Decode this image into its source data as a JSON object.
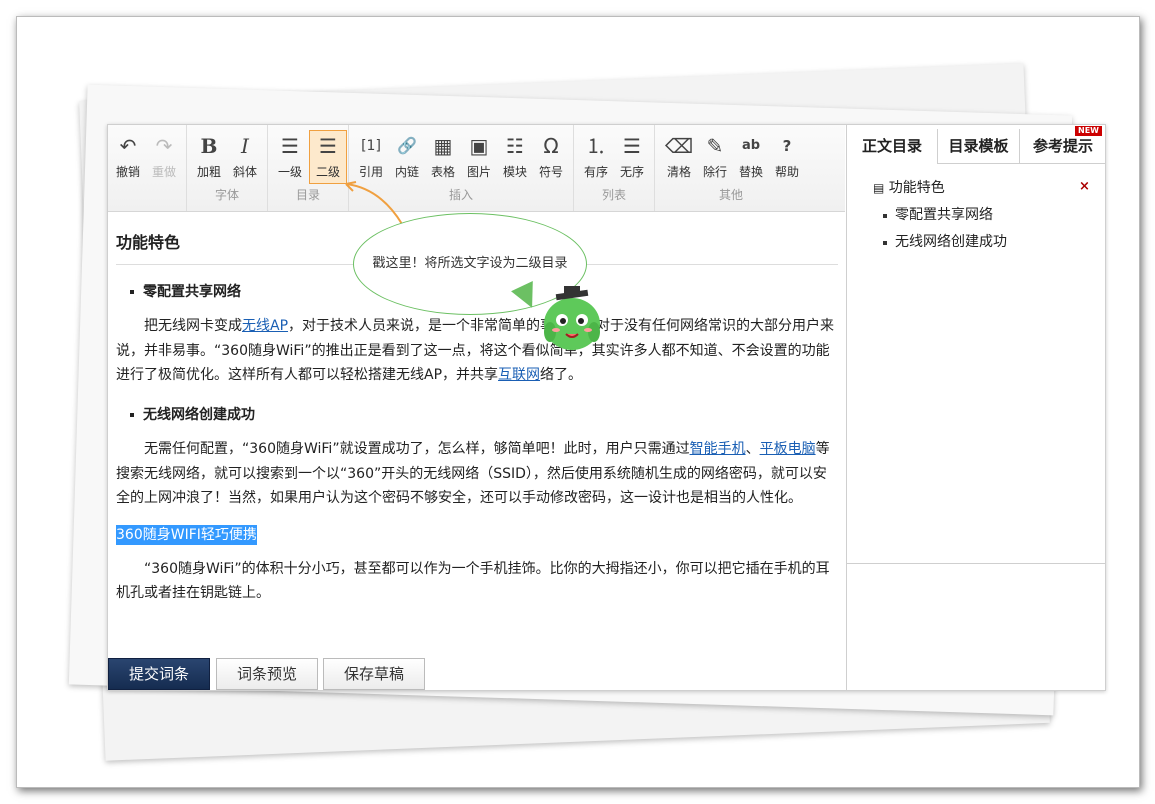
{
  "toolbar": {
    "groups": [
      {
        "label": "",
        "buttons": [
          {
            "icon": "undo-icon",
            "glyph": "↶",
            "label": "撤销"
          },
          {
            "icon": "redo-icon",
            "glyph": "↷",
            "label": "重做"
          }
        ]
      },
      {
        "label": "字体",
        "buttons": [
          {
            "icon": "bold-icon",
            "glyph": "B",
            "label": "加粗"
          },
          {
            "icon": "italic-icon",
            "glyph": "I",
            "label": "斜体"
          }
        ]
      },
      {
        "label": "目录",
        "buttons": [
          {
            "icon": "heading1-icon",
            "glyph": "☰",
            "label": "一级"
          },
          {
            "icon": "heading2-icon",
            "glyph": "☰",
            "label": "二级"
          }
        ]
      },
      {
        "label": "插入",
        "buttons": [
          {
            "icon": "quote-icon",
            "glyph": "[1]",
            "label": "引用"
          },
          {
            "icon": "link-icon",
            "glyph": "🔗",
            "label": "内链"
          },
          {
            "icon": "table-icon",
            "glyph": "▦",
            "label": "表格"
          },
          {
            "icon": "image-icon",
            "glyph": "▣",
            "label": "图片"
          },
          {
            "icon": "module-icon",
            "glyph": "☷",
            "label": "模块"
          },
          {
            "icon": "symbol-icon",
            "glyph": "Ω",
            "label": "符号"
          }
        ]
      },
      {
        "label": "列表",
        "buttons": [
          {
            "icon": "ordered-list-icon",
            "glyph": "⒈",
            "label": "有序"
          },
          {
            "icon": "unordered-list-icon",
            "glyph": "☰",
            "label": "无序"
          }
        ]
      },
      {
        "label": "其他",
        "buttons": [
          {
            "icon": "clear-format-icon",
            "glyph": "⌫",
            "label": "清格"
          },
          {
            "icon": "remove-format-icon",
            "glyph": "✎",
            "label": "除行"
          },
          {
            "icon": "replace-icon",
            "glyph": "ab",
            "label": "替换"
          },
          {
            "icon": "help-icon",
            "glyph": "?",
            "label": "帮助"
          }
        ]
      }
    ]
  },
  "side": {
    "tabs": [
      "正文目录",
      "目录模板",
      "参考提示"
    ],
    "new_badge": "NEW",
    "toc": {
      "root": "功能特色",
      "items": [
        "零配置共享网络",
        "无线网络创建成功"
      ]
    },
    "close_glyph": "×"
  },
  "content": {
    "title": "功能特色",
    "s1_heading": "零配置共享网络",
    "p1_a": "把无线网卡变成",
    "p1_link1": "无线AP",
    "p1_b": "，对于技术人员来说，是一个非常简单的事情，但对于没有任何网络常识的大部分用户来说，并非易事。“360随身WiFi”的推出正是看到了这一点，将这个看似简单，其实许多人都不知道、不会设置的功能进行了极简优化。这样所有人都可以轻松搭建无线AP，并共享",
    "p1_link2": "互联网",
    "p1_c": "络了。",
    "s2_heading": "无线网络创建成功",
    "p2_a": "无需任何配置，“360随身WiFi”就设置成功了，怎么样，够简单吧！此时，用户只需通过",
    "p2_link1": "智能手机",
    "p2_sep": "、",
    "p2_link2": "平板电脑",
    "p2_b": "等搜索无线网络，就可以搜索到一个以“360”开头的无线网络（SSID），然后使用系统随机生成的网络密码，就可以安全的上网冲浪了！当然，如果用户认为这个密码不够安全，还可以手动修改密码，这一设计也是相当的人性化。",
    "selected": "360随身WIFI轻巧便携",
    "p3": "“360随身WiFi”的体积十分小巧，甚至都可以作为一个手机挂饰。比你的大拇指还小，你可以把它插在手机的耳机孔或者挂在钥匙链上。"
  },
  "tooltip": "戳这里！将所选文字设为二级目录",
  "footer": {
    "submit": "提交词条",
    "preview": "词条预览",
    "draft": "保存草稿"
  },
  "colors": {
    "accent": "#f0a040",
    "bubble_border": "#6cc063",
    "link": "#1a5fb4",
    "selection": "#3399ff",
    "primary_btn": "#1e3760"
  }
}
